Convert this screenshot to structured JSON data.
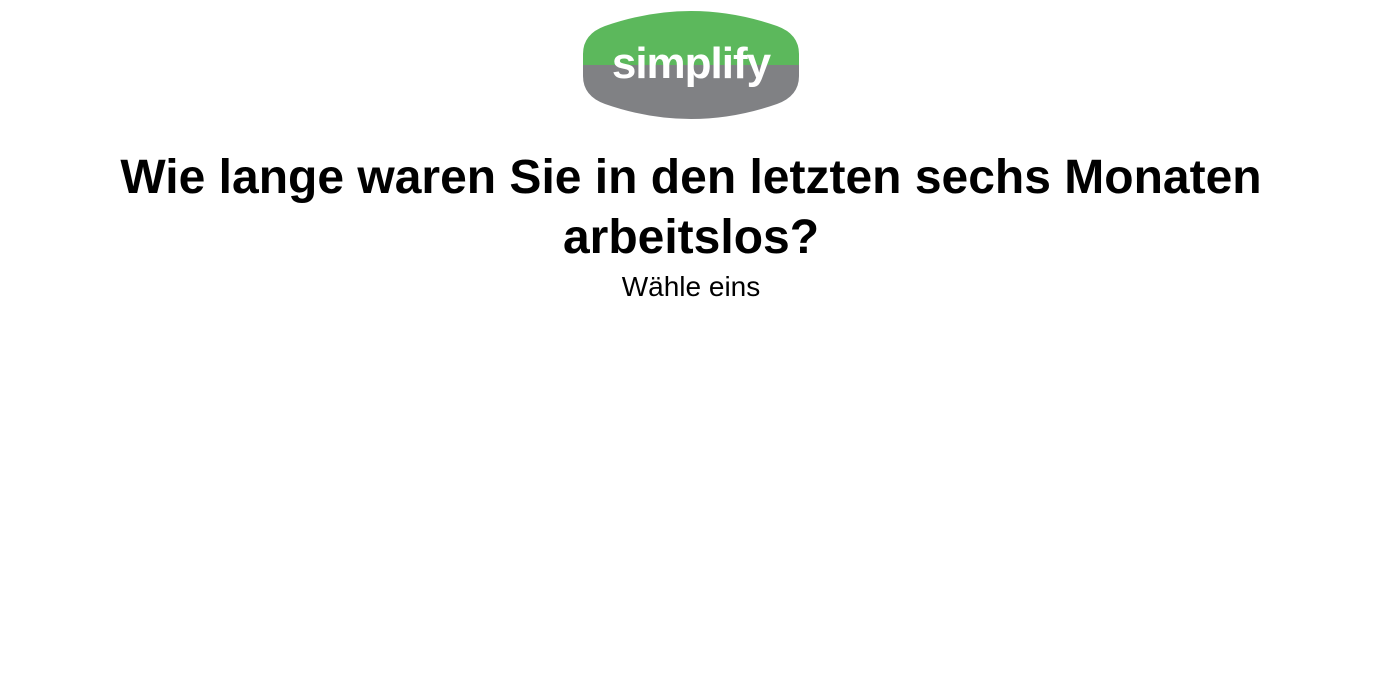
{
  "brand": {
    "logo_text": "simplify",
    "colors": {
      "green": "#5cb85c",
      "gray": "#808184",
      "text": "#ffffff"
    }
  },
  "question": {
    "title": "Wie lange waren Sie in den letzten sechs Monaten arbeitslos?",
    "subtitle": "Wähle eins"
  }
}
